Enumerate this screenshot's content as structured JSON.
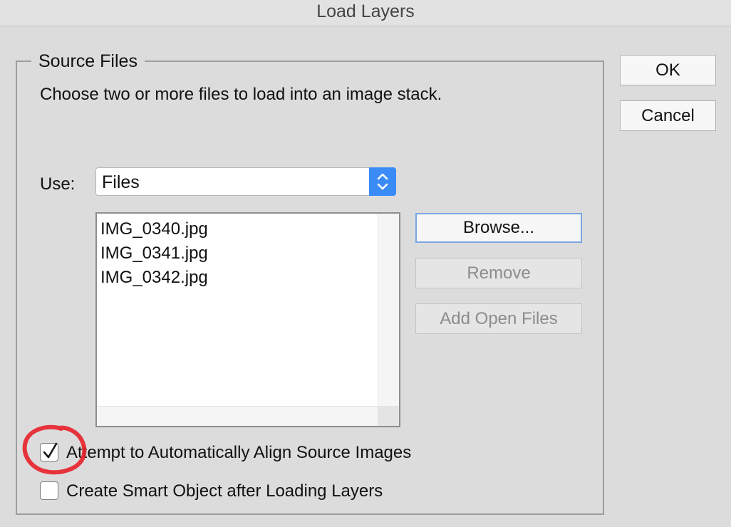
{
  "window": {
    "title": "Load Layers"
  },
  "source_files": {
    "group_label": "Source Files",
    "instruction": "Choose two or more files to load into an image stack.",
    "use_label": "Use:",
    "use_select": {
      "value": "Files"
    },
    "files": [
      "IMG_0340.jpg",
      "IMG_0341.jpg",
      "IMG_0342.jpg"
    ],
    "buttons": {
      "browse": "Browse...",
      "remove": "Remove",
      "add_open_files": "Add Open Files"
    }
  },
  "dialog_buttons": {
    "ok": "OK",
    "cancel": "Cancel"
  },
  "options": [
    {
      "label": "Attempt to Automatically Align Source Images",
      "checked": true
    },
    {
      "label": "Create Smart Object after Loading Layers",
      "checked": false
    }
  ],
  "annotation": {
    "color": "#e8202a"
  },
  "colors": {
    "accent": "#3a8bf6",
    "background": "#dcdcdc"
  }
}
